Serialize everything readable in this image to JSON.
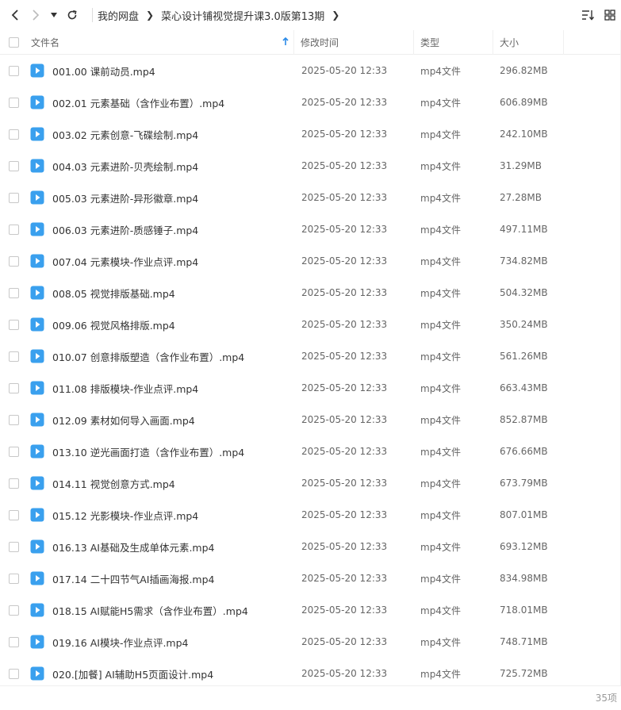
{
  "toolbar": {
    "breadcrumb": [
      "我的网盘",
      "菜心设计铺视觉提升课3.0版第13期"
    ]
  },
  "columns": {
    "name": "文件名",
    "time": "修改时间",
    "type": "类型",
    "size": "大小"
  },
  "files": [
    {
      "name": "001.00 课前动员.mp4",
      "time": "2025-05-20 12:33",
      "type": "mp4文件",
      "size": "296.82MB"
    },
    {
      "name": "002.01 元素基础（含作业布置）.mp4",
      "time": "2025-05-20 12:33",
      "type": "mp4文件",
      "size": "606.89MB"
    },
    {
      "name": "003.02 元素创意-飞碟绘制.mp4",
      "time": "2025-05-20 12:33",
      "type": "mp4文件",
      "size": "242.10MB"
    },
    {
      "name": "004.03 元素进阶-贝壳绘制.mp4",
      "time": "2025-05-20 12:33",
      "type": "mp4文件",
      "size": "31.29MB"
    },
    {
      "name": "005.03 元素进阶-异形徽章.mp4",
      "time": "2025-05-20 12:33",
      "type": "mp4文件",
      "size": "27.28MB"
    },
    {
      "name": "006.03 元素进阶-质感锤子.mp4",
      "time": "2025-05-20 12:33",
      "type": "mp4文件",
      "size": "497.11MB"
    },
    {
      "name": "007.04 元素模块-作业点评.mp4",
      "time": "2025-05-20 12:33",
      "type": "mp4文件",
      "size": "734.82MB"
    },
    {
      "name": "008.05 视觉排版基础.mp4",
      "time": "2025-05-20 12:33",
      "type": "mp4文件",
      "size": "504.32MB"
    },
    {
      "name": "009.06 视觉风格排版.mp4",
      "time": "2025-05-20 12:33",
      "type": "mp4文件",
      "size": "350.24MB"
    },
    {
      "name": "010.07 创意排版塑造（含作业布置）.mp4",
      "time": "2025-05-20 12:33",
      "type": "mp4文件",
      "size": "561.26MB"
    },
    {
      "name": "011.08 排版模块-作业点评.mp4",
      "time": "2025-05-20 12:33",
      "type": "mp4文件",
      "size": "663.43MB"
    },
    {
      "name": "012.09 素材如何导入画面.mp4",
      "time": "2025-05-20 12:33",
      "type": "mp4文件",
      "size": "852.87MB"
    },
    {
      "name": "013.10 逆光画面打造（含作业布置）.mp4",
      "time": "2025-05-20 12:33",
      "type": "mp4文件",
      "size": "676.66MB"
    },
    {
      "name": "014.11 视觉创意方式.mp4",
      "time": "2025-05-20 12:33",
      "type": "mp4文件",
      "size": "673.79MB"
    },
    {
      "name": "015.12 光影模块-作业点评.mp4",
      "time": "2025-05-20 12:33",
      "type": "mp4文件",
      "size": "807.01MB"
    },
    {
      "name": "016.13 AI基础及生成单体元素.mp4",
      "time": "2025-05-20 12:33",
      "type": "mp4文件",
      "size": "693.12MB"
    },
    {
      "name": "017.14 二十四节气AI插画海报.mp4",
      "time": "2025-05-20 12:33",
      "type": "mp4文件",
      "size": "834.98MB"
    },
    {
      "name": "018.15 AI赋能H5需求（含作业布置）.mp4",
      "time": "2025-05-20 12:33",
      "type": "mp4文件",
      "size": "718.01MB"
    },
    {
      "name": "019.16 AI模块-作业点评.mp4",
      "time": "2025-05-20 12:33",
      "type": "mp4文件",
      "size": "748.71MB"
    },
    {
      "name": "020.[加餐] AI辅助H5页面设计.mp4",
      "time": "2025-05-20 12:33",
      "type": "mp4文件",
      "size": "725.72MB"
    }
  ],
  "footer": {
    "count": "35项"
  },
  "colors": {
    "file_icon": "#3aa0ee",
    "sort_arrow": "#2b8ae8"
  }
}
